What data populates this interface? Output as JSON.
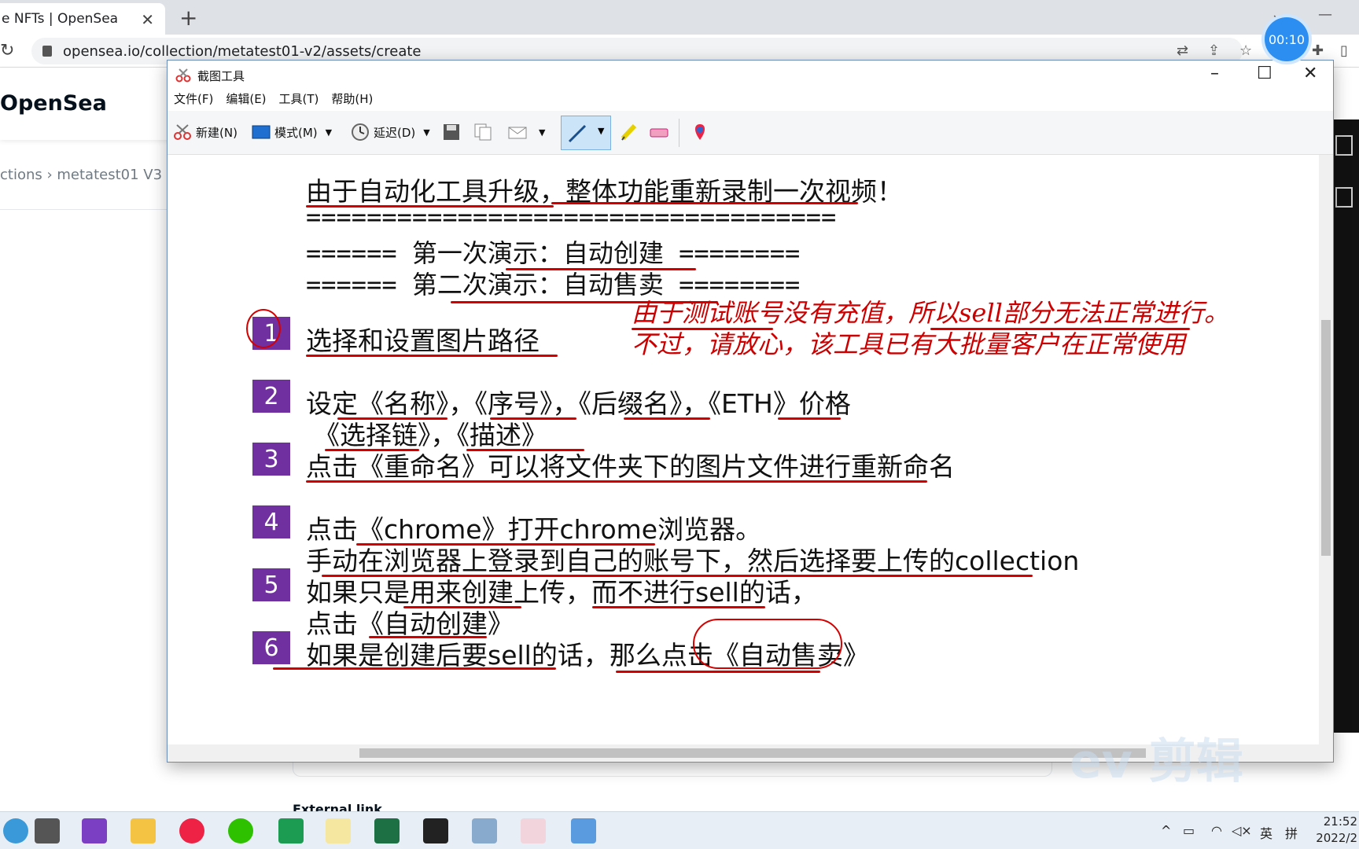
{
  "browser": {
    "tab_title": "e NFTs | OpenSea",
    "tab_close": "✕",
    "new_tab": "+",
    "url": "opensea.io/collection/metatest01-v2/assets/create"
  },
  "recording": {
    "time": "00:10"
  },
  "opensea": {
    "logo": "OpenSea",
    "breadcrumb": "ctions  ›  metatest01 V3",
    "external_link_label": "External link"
  },
  "snip": {
    "title": "截图工具",
    "menu": [
      "文件(F)",
      "编辑(E)",
      "工具(T)",
      "帮助(H)"
    ],
    "toolbar": {
      "new": "新建(N)",
      "mode": "模式(M)",
      "delay": "延迟(D)"
    },
    "content": {
      "heading": "由于自动化工具升级，整体功能重新录制一次视频！",
      "separator": "===================================",
      "demo1": "======   第一次演示：自动创建   ========",
      "demo2": "======   第二次演示：自动售卖   ========",
      "note1": "由于测试账号没有充值，所以sell部分无法正常进行。",
      "note2": "不过，请放心，该工具已有大批量客户在正常使用",
      "steps": [
        {
          "n": "1",
          "text": "选择和设置图片路径"
        },
        {
          "n": "2",
          "text": "设定《名称》，《序号》，《后缀名》，《ETH》价格"
        },
        {
          "n": "",
          "text": "《选择链》，《描述》"
        },
        {
          "n": "3",
          "text": "点击《重命名》可以将文件夹下的图片文件进行重新命名"
        },
        {
          "n": "4",
          "text": "点击《chrome》打开chrome浏览器。"
        },
        {
          "n": "",
          "text": "手动在浏览器上登录到自己的账号下，然后选择要上传的collection"
        },
        {
          "n": "5",
          "text": "如果只是用来创建上传，而不进行sell的话，"
        },
        {
          "n": "",
          "text": "点击《自动创建》"
        },
        {
          "n": "6",
          "text": "如果是创建后要sell的话，那么点击《自动售卖》"
        }
      ]
    }
  },
  "watermark": "ev 剪辑",
  "taskbar": {
    "ime": "英",
    "ime2": "拼",
    "time": "21:52",
    "date": "2022/2"
  }
}
